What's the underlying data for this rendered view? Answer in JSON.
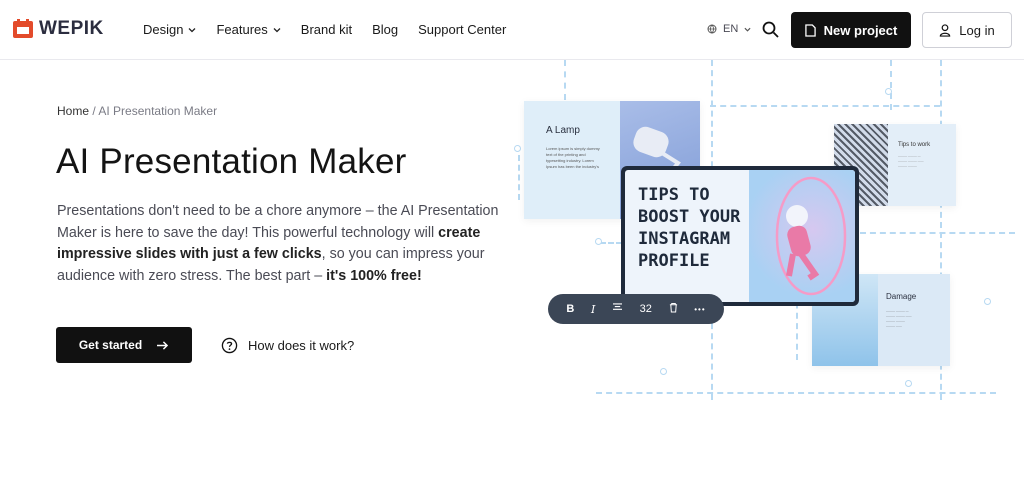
{
  "header": {
    "logo_text": "WEPIK",
    "nav": [
      {
        "label": "Design",
        "has_dropdown": true
      },
      {
        "label": "Features",
        "has_dropdown": true
      },
      {
        "label": "Brand kit",
        "has_dropdown": false
      },
      {
        "label": "Blog",
        "has_dropdown": false
      },
      {
        "label": "Support Center",
        "has_dropdown": false
      }
    ],
    "language": "EN",
    "new_project_label": "New project",
    "login_label": "Log in"
  },
  "breadcrumb": {
    "home": "Home",
    "separator": "/",
    "current": "AI Presentation Maker"
  },
  "hero": {
    "title": "AI Presentation Maker",
    "desc_part1": "Presentations don't need to be a chore anymore – the AI Presentation Maker is here to save the day! This powerful technology will ",
    "desc_bold1": "create impressive slides with just a few clicks",
    "desc_part2": ", so you can impress your audience with zero stress. The best part – ",
    "desc_bold2": "it's 100% free!",
    "cta_label": "Get started",
    "how_label": "How does it work?"
  },
  "illustration": {
    "lamp_title": "A Lamp",
    "lamp_text": "Lorem ipsum is simply dummy text of the printing and typesetting industry. Lorem Ipsum has been the industry's",
    "tips_small_title": "Tips to work",
    "damage_title": "Damage",
    "main_card_text": "TIPS TO BOOST YOUR INSTAGRAM PROFILE",
    "toolbar": {
      "bold": "B",
      "italic": "I",
      "font_size": "32",
      "more": "•••"
    }
  },
  "colors": {
    "brand_logo": "#e34b2b",
    "button_dark": "#111111",
    "accent_dash": "#b7d9f2"
  }
}
